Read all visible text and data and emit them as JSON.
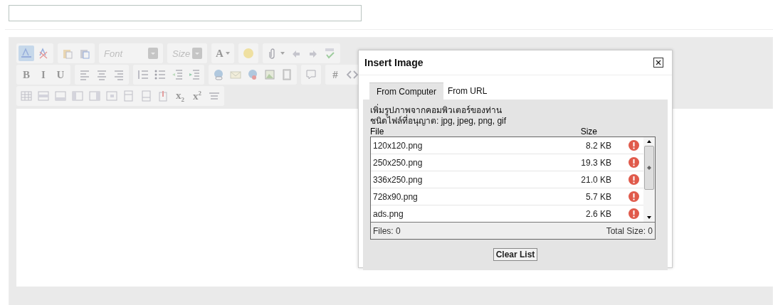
{
  "toolbar": [
    [
      [
        {
          "kind": "icon",
          "active": true
        },
        {
          "kind": "icon",
          "active": false
        }
      ],
      [
        {
          "kind": "icon",
          "active": false
        },
        {
          "kind": "icon",
          "active": false
        }
      ],
      [
        {
          "kind": "dropdown",
          "placeholder": "Font"
        }
      ],
      [
        {
          "kind": "dropdown",
          "placeholder": "Size"
        }
      ],
      [
        {
          "kind": "text",
          "label": "A",
          "caret": true
        }
      ],
      [
        {
          "kind": "icon",
          "active": false
        }
      ],
      [
        {
          "kind": "icon",
          "active": false,
          "caret": true
        },
        {
          "kind": "icon",
          "active": false
        },
        {
          "kind": "icon",
          "active": false
        },
        {
          "kind": "icon",
          "active": false
        }
      ]
    ],
    [
      [
        {
          "kind": "text",
          "label": "B"
        },
        {
          "kind": "text",
          "label": "I"
        },
        {
          "kind": "text",
          "label": "U"
        }
      ],
      [
        {
          "kind": "icon",
          "active": false
        },
        {
          "kind": "icon",
          "active": false
        },
        {
          "kind": "icon",
          "active": false
        }
      ],
      [
        {
          "kind": "icon",
          "active": false
        },
        {
          "kind": "icon",
          "active": false
        },
        {
          "kind": "icon",
          "active": false
        },
        {
          "kind": "icon",
          "active": false
        }
      ],
      [
        {
          "kind": "icon",
          "active": false
        },
        {
          "kind": "icon",
          "active": false
        },
        {
          "kind": "icon",
          "active": false
        },
        {
          "kind": "icon",
          "active": false
        },
        {
          "kind": "icon",
          "active": false
        }
      ],
      [
        {
          "kind": "icon",
          "active": false
        }
      ],
      [
        {
          "kind": "text",
          "label": "#"
        },
        {
          "kind": "icon",
          "active": false
        }
      ]
    ],
    [
      [
        {
          "kind": "icon",
          "active": false
        },
        {
          "kind": "icon",
          "active": false
        },
        {
          "kind": "icon",
          "active": false
        },
        {
          "kind": "icon",
          "active": false
        },
        {
          "kind": "icon",
          "active": false
        },
        {
          "kind": "icon",
          "active": false
        },
        {
          "kind": "icon",
          "active": false
        },
        {
          "kind": "icon",
          "active": false
        },
        {
          "kind": "icon",
          "active": false
        },
        {
          "kind": "text",
          "label": "x$_{2}$"
        },
        {
          "kind": "text",
          "label": "x$^{2}$"
        },
        {
          "kind": "icon",
          "active": false
        }
      ]
    ]
  ],
  "dialog": {
    "title": "Insert Image",
    "tabs": [
      {
        "label": "From Computer",
        "selected": true
      },
      {
        "label": "From URL",
        "selected": false
      }
    ],
    "intro": "เพิ่มรูปภาพจากคอมพิวเตอร์ของท่าน",
    "allowed": "ชนิดไฟล์ที่อนุญาต: jpg, jpeg, png, gif",
    "columns": [
      "File",
      "Size"
    ],
    "files": [
      {
        "name": "120x120.png",
        "size": "8.2 KB"
      },
      {
        "name": "250x250.png",
        "size": "19.3 KB"
      },
      {
        "name": "336x250.png",
        "size": "21.0 KB"
      },
      {
        "name": "728x90.png",
        "size": "5.7 KB"
      },
      {
        "name": "ads.png",
        "size": "2.6 KB"
      }
    ],
    "files_count": "Files: 0",
    "total_size": "Total Size: 0",
    "clear_button": "Clear List"
  }
}
